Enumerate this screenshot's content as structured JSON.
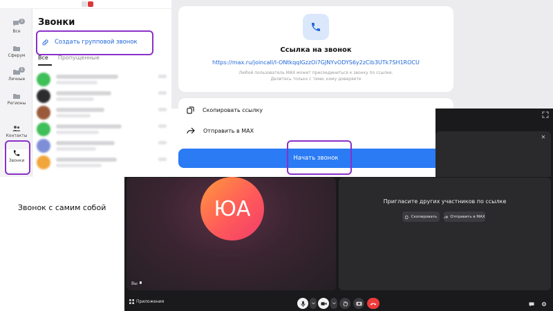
{
  "rail": {
    "items": [
      {
        "label": "Все",
        "badge": "2"
      },
      {
        "label": "Сферум"
      },
      {
        "label": "Личные",
        "badge": "1"
      },
      {
        "label": "Регионы"
      },
      {
        "label": "Контакты"
      },
      {
        "label": "Звонки"
      }
    ]
  },
  "calls": {
    "title": "Звонки",
    "create_group": "Создать групповой звонок",
    "tabs": [
      "Все",
      "Пропущенные"
    ]
  },
  "link_panel": {
    "title": "Ссылка на звонок",
    "url": "https://max.ru/joincall/l-ONtkqqlGzzOi7GJNYvODYS6y2zCib3UTk7SH1ROCU",
    "note_line1": "Любой пользователь MAX может присоединиться к звонку по ссылке.",
    "note_line2": "Делитесь только с теми, кому доверяете",
    "copy_label": "Скопировать ссылку",
    "send_label": "Отправить в MAX",
    "start_label": "Начать звонок"
  },
  "call": {
    "avatar_initials": "ЮА",
    "self_label": "Вы",
    "invite_text": "Пригласите других участников по ссылке",
    "copy_btn": "Скопировать",
    "send_btn": "Отправить в MAX",
    "apps_label": "Приложения"
  },
  "caption": "Звонок с самим собой",
  "colors": {
    "accent": "#2a7bf4",
    "highlight": "#8a2fc9",
    "end_call": "#ef3b3b"
  }
}
